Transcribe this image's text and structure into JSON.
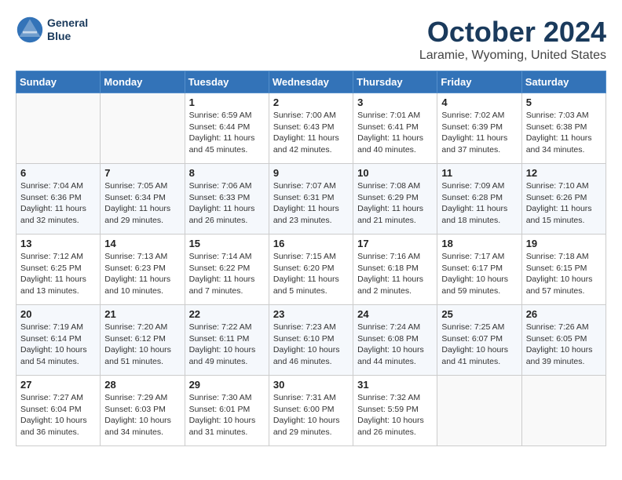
{
  "header": {
    "logo_line1": "General",
    "logo_line2": "Blue",
    "month": "October 2024",
    "location": "Laramie, Wyoming, United States"
  },
  "weekdays": [
    "Sunday",
    "Monday",
    "Tuesday",
    "Wednesday",
    "Thursday",
    "Friday",
    "Saturday"
  ],
  "weeks": [
    [
      {
        "day": "",
        "info": ""
      },
      {
        "day": "",
        "info": ""
      },
      {
        "day": "1",
        "info": "Sunrise: 6:59 AM\nSunset: 6:44 PM\nDaylight: 11 hours and 45 minutes."
      },
      {
        "day": "2",
        "info": "Sunrise: 7:00 AM\nSunset: 6:43 PM\nDaylight: 11 hours and 42 minutes."
      },
      {
        "day": "3",
        "info": "Sunrise: 7:01 AM\nSunset: 6:41 PM\nDaylight: 11 hours and 40 minutes."
      },
      {
        "day": "4",
        "info": "Sunrise: 7:02 AM\nSunset: 6:39 PM\nDaylight: 11 hours and 37 minutes."
      },
      {
        "day": "5",
        "info": "Sunrise: 7:03 AM\nSunset: 6:38 PM\nDaylight: 11 hours and 34 minutes."
      }
    ],
    [
      {
        "day": "6",
        "info": "Sunrise: 7:04 AM\nSunset: 6:36 PM\nDaylight: 11 hours and 32 minutes."
      },
      {
        "day": "7",
        "info": "Sunrise: 7:05 AM\nSunset: 6:34 PM\nDaylight: 11 hours and 29 minutes."
      },
      {
        "day": "8",
        "info": "Sunrise: 7:06 AM\nSunset: 6:33 PM\nDaylight: 11 hours and 26 minutes."
      },
      {
        "day": "9",
        "info": "Sunrise: 7:07 AM\nSunset: 6:31 PM\nDaylight: 11 hours and 23 minutes."
      },
      {
        "day": "10",
        "info": "Sunrise: 7:08 AM\nSunset: 6:29 PM\nDaylight: 11 hours and 21 minutes."
      },
      {
        "day": "11",
        "info": "Sunrise: 7:09 AM\nSunset: 6:28 PM\nDaylight: 11 hours and 18 minutes."
      },
      {
        "day": "12",
        "info": "Sunrise: 7:10 AM\nSunset: 6:26 PM\nDaylight: 11 hours and 15 minutes."
      }
    ],
    [
      {
        "day": "13",
        "info": "Sunrise: 7:12 AM\nSunset: 6:25 PM\nDaylight: 11 hours and 13 minutes."
      },
      {
        "day": "14",
        "info": "Sunrise: 7:13 AM\nSunset: 6:23 PM\nDaylight: 11 hours and 10 minutes."
      },
      {
        "day": "15",
        "info": "Sunrise: 7:14 AM\nSunset: 6:22 PM\nDaylight: 11 hours and 7 minutes."
      },
      {
        "day": "16",
        "info": "Sunrise: 7:15 AM\nSunset: 6:20 PM\nDaylight: 11 hours and 5 minutes."
      },
      {
        "day": "17",
        "info": "Sunrise: 7:16 AM\nSunset: 6:18 PM\nDaylight: 11 hours and 2 minutes."
      },
      {
        "day": "18",
        "info": "Sunrise: 7:17 AM\nSunset: 6:17 PM\nDaylight: 10 hours and 59 minutes."
      },
      {
        "day": "19",
        "info": "Sunrise: 7:18 AM\nSunset: 6:15 PM\nDaylight: 10 hours and 57 minutes."
      }
    ],
    [
      {
        "day": "20",
        "info": "Sunrise: 7:19 AM\nSunset: 6:14 PM\nDaylight: 10 hours and 54 minutes."
      },
      {
        "day": "21",
        "info": "Sunrise: 7:20 AM\nSunset: 6:12 PM\nDaylight: 10 hours and 51 minutes."
      },
      {
        "day": "22",
        "info": "Sunrise: 7:22 AM\nSunset: 6:11 PM\nDaylight: 10 hours and 49 minutes."
      },
      {
        "day": "23",
        "info": "Sunrise: 7:23 AM\nSunset: 6:10 PM\nDaylight: 10 hours and 46 minutes."
      },
      {
        "day": "24",
        "info": "Sunrise: 7:24 AM\nSunset: 6:08 PM\nDaylight: 10 hours and 44 minutes."
      },
      {
        "day": "25",
        "info": "Sunrise: 7:25 AM\nSunset: 6:07 PM\nDaylight: 10 hours and 41 minutes."
      },
      {
        "day": "26",
        "info": "Sunrise: 7:26 AM\nSunset: 6:05 PM\nDaylight: 10 hours and 39 minutes."
      }
    ],
    [
      {
        "day": "27",
        "info": "Sunrise: 7:27 AM\nSunset: 6:04 PM\nDaylight: 10 hours and 36 minutes."
      },
      {
        "day": "28",
        "info": "Sunrise: 7:29 AM\nSunset: 6:03 PM\nDaylight: 10 hours and 34 minutes."
      },
      {
        "day": "29",
        "info": "Sunrise: 7:30 AM\nSunset: 6:01 PM\nDaylight: 10 hours and 31 minutes."
      },
      {
        "day": "30",
        "info": "Sunrise: 7:31 AM\nSunset: 6:00 PM\nDaylight: 10 hours and 29 minutes."
      },
      {
        "day": "31",
        "info": "Sunrise: 7:32 AM\nSunset: 5:59 PM\nDaylight: 10 hours and 26 minutes."
      },
      {
        "day": "",
        "info": ""
      },
      {
        "day": "",
        "info": ""
      }
    ]
  ]
}
